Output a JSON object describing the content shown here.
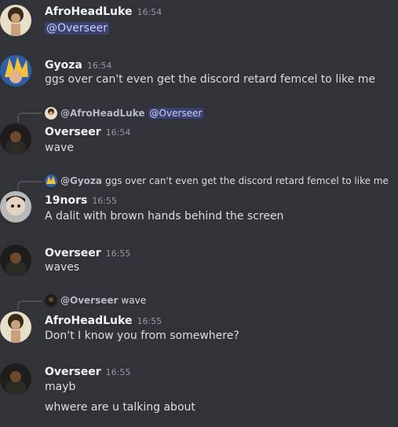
{
  "messages": [
    {
      "author": "AfroHeadLuke",
      "timestamp": "16:54",
      "avatar": "afroheadluke-avatar",
      "lines": [],
      "mention": "@Overseer"
    },
    {
      "author": "Gyoza",
      "timestamp": "16:54",
      "avatar": "gyoza-avatar",
      "lines": [
        "ggs over can't even get the discord retard femcel to like me"
      ]
    },
    {
      "reply": {
        "name": "@AfroHeadLuke",
        "mention": "@Overseer"
      },
      "author": "Overseer",
      "timestamp": "16:54",
      "avatar": "overseer-avatar",
      "lines": [
        "wave"
      ]
    },
    {
      "reply": {
        "name": "@Gyoza",
        "text": "ggs over can't even get the discord retard femcel to like me"
      },
      "author": "19nors",
      "timestamp": "16:55",
      "avatar": "19nors-avatar",
      "lines": [
        "A dalit with brown hands behind the screen"
      ]
    },
    {
      "author": "Overseer",
      "timestamp": "16:55",
      "avatar": "overseer-avatar",
      "lines": [
        "waves"
      ]
    },
    {
      "reply": {
        "name": "@Overseer",
        "text": "wave"
      },
      "author": "AfroHeadLuke",
      "timestamp": "16:55",
      "avatar": "afroheadluke-avatar",
      "lines": [
        "Don't I know you from somewhere?"
      ]
    },
    {
      "author": "Overseer",
      "timestamp": "16:55",
      "avatar": "overseer-avatar",
      "lines": [
        "mayb",
        "whwere are u talking about"
      ]
    }
  ],
  "colors": {
    "background": "#313338",
    "mention_bg": "#3c4270",
    "mention_text": "#c9cdfb",
    "author": "#f2f3f5",
    "timestamp": "#949ba4"
  }
}
